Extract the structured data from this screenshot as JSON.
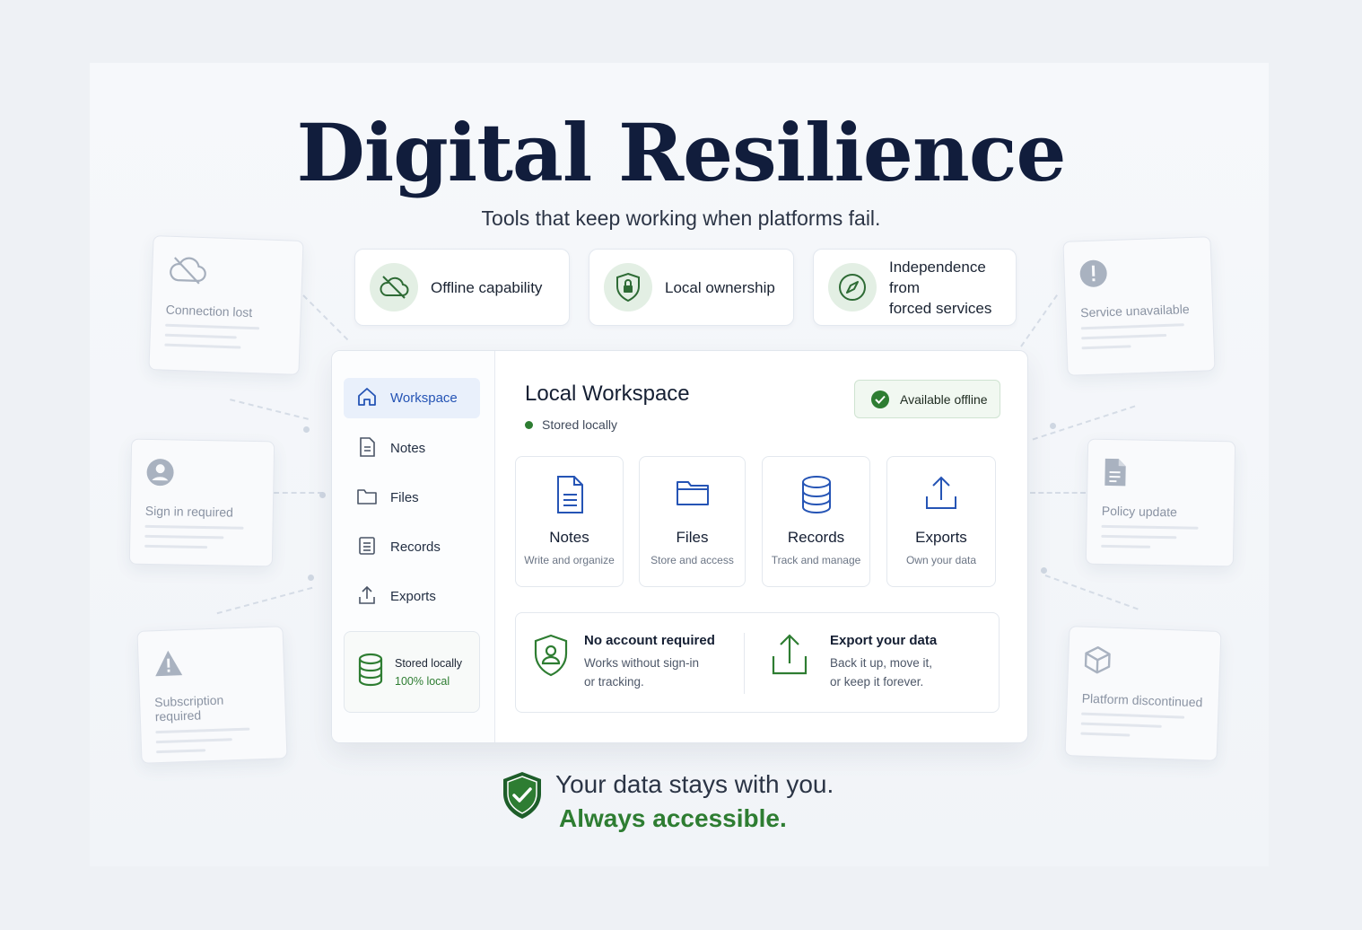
{
  "header": {
    "title": "Digital Resilience",
    "subtitle": "Tools that keep working when platforms fail."
  },
  "features": [
    {
      "label": "Offline capability",
      "icon": "cloud-off-icon"
    },
    {
      "label": "Local ownership",
      "icon": "shield-lock-icon"
    },
    {
      "label": "Independence from forced services",
      "line1": "Independence from",
      "line2": "forced services",
      "icon": "compass-icon"
    }
  ],
  "ghost_cards": {
    "connection_lost": "Connection lost",
    "sign_in_required": "Sign in required",
    "subscription_required": "Subscription required",
    "service_unavailable": "Service unavailable",
    "policy_update": "Policy update",
    "platform_discontinued": "Platform discontinued"
  },
  "sidebar": {
    "items": [
      {
        "label": "Workspace",
        "icon": "home-icon",
        "active": true
      },
      {
        "label": "Notes",
        "icon": "document-icon"
      },
      {
        "label": "Files",
        "icon": "folder-icon"
      },
      {
        "label": "Records",
        "icon": "records-icon"
      },
      {
        "label": "Exports",
        "icon": "upload-icon"
      }
    ],
    "storage": {
      "title": "Stored locally",
      "value": "100% local"
    }
  },
  "workspace": {
    "title": "Local Workspace",
    "status": "Stored locally",
    "badge": "Available offline",
    "cards": [
      {
        "name": "Notes",
        "desc": "Write and organize",
        "icon": "document-icon"
      },
      {
        "name": "Files",
        "desc": "Store and access",
        "icon": "folder-icon"
      },
      {
        "name": "Records",
        "desc": "Track and manage",
        "icon": "database-icon"
      },
      {
        "name": "Exports",
        "desc": "Own your data",
        "icon": "upload-icon"
      }
    ],
    "info": [
      {
        "heading": "No account required",
        "line1": "Works without sign-in",
        "line2": "or tracking.",
        "icon": "user-shield-icon"
      },
      {
        "heading": "Export your data",
        "line1": "Back it up, move it,",
        "line2": "or keep it forever.",
        "icon": "upload-icon"
      }
    ]
  },
  "footer": {
    "line1": "Your data stays with you.",
    "line2": "Always accessible."
  },
  "colors": {
    "accent_green": "#2e7d32",
    "accent_blue": "#2554b5",
    "title_navy": "#111d3c"
  }
}
